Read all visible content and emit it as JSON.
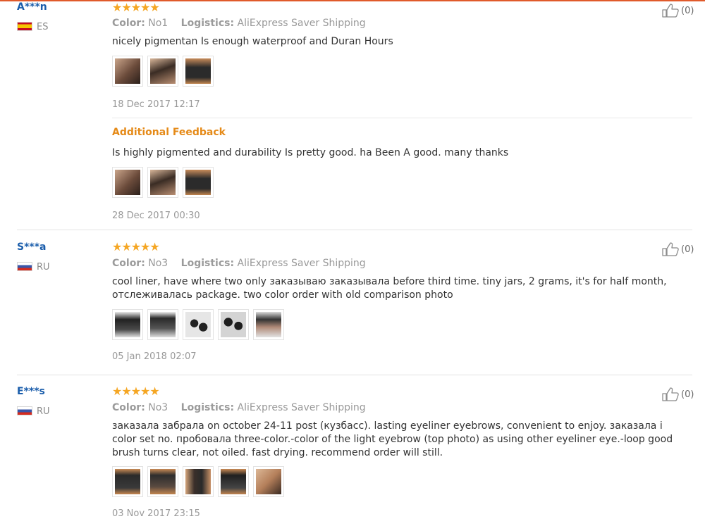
{
  "labels": {
    "color": "Color:",
    "logistics": "Logistics:",
    "additional_feedback": "Additional Feedback"
  },
  "reviews": [
    {
      "user": "A***n",
      "country": "ES",
      "stars": "★★★★★",
      "color": "No1",
      "shipping": "AliExpress Saver Shipping",
      "text": "nicely pigmentan Is enough waterproof and Duran Hours",
      "date": "18 Dec 2017 12:17",
      "likes": "(0)",
      "additional": {
        "text": "Is highly pigmented and durability Is pretty good. ha Been A good. many thanks",
        "date": "28 Dec 2017 00:30"
      }
    },
    {
      "user": "S***a",
      "country": "RU",
      "stars": "★★★★★",
      "color": "No3",
      "shipping": "AliExpress Saver Shipping",
      "text": "cool liner, have where two only заказываю заказывала before third time. tiny jars, 2 grams, it's for half month, отслеживалась package. two color order with old comparison photo",
      "date": "05 Jan 2018 02:07",
      "likes": "(0)"
    },
    {
      "user": "E***s",
      "country": "RU",
      "stars": "★★★★★",
      "color": "No3",
      "shipping": "AliExpress Saver Shipping",
      "text": "заказала забрала on october 24-11 post (кузбасс). lasting eyeliner eyebrows, convenient to enjoy. заказала i color set no. пробовала three-color.-color of the light eyebrow (top photo) as using other eyeliner eye.-loop good brush turns clear, not oiled. fast drying. recommend order will still.",
      "date": "03 Nov 2017 23:15",
      "likes": "(0)"
    }
  ],
  "colors": {
    "accent_orange": "#e58a18",
    "star": "#f5a623",
    "user_blue": "#1a5dab",
    "top_bar": "#e05a2b"
  }
}
